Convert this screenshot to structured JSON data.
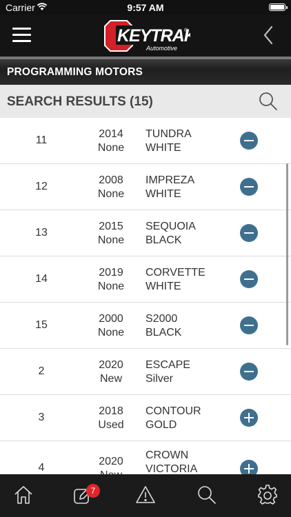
{
  "status_bar": {
    "carrier": "Carrier",
    "time": "9:57 AM"
  },
  "header": {
    "logo_text": "KEYTRAK",
    "logo_registered": "®",
    "logo_subtitle": "Automotive",
    "menu_icon": "hamburger-icon",
    "back_icon": "chevron-left-icon"
  },
  "section": {
    "title": "PROGRAMMING MOTORS"
  },
  "results": {
    "label": "SEARCH RESULTS (15)",
    "search_icon": "search-icon"
  },
  "rows": [
    {
      "num": "11",
      "year": "2014",
      "condition": "None",
      "model": "TUNDRA",
      "color": "WHITE",
      "action": "remove"
    },
    {
      "num": "12",
      "year": "2008",
      "condition": "None",
      "model": "IMPREZA",
      "color": "WHITE",
      "action": "remove"
    },
    {
      "num": "13",
      "year": "2015",
      "condition": "None",
      "model": "SEQUOIA",
      "color": "BLACK",
      "action": "remove"
    },
    {
      "num": "14",
      "year": "2019",
      "condition": "None",
      "model": "CORVETTE",
      "color": "WHITE",
      "action": "remove"
    },
    {
      "num": "15",
      "year": "2000",
      "condition": "None",
      "model": "S2000",
      "color": "BLACK",
      "action": "remove"
    },
    {
      "num": "2",
      "year": "2020",
      "condition": "New",
      "model": "ESCAPE",
      "color": "Silver",
      "action": "remove"
    },
    {
      "num": "3",
      "year": "2018",
      "condition": "Used",
      "model": "CONTOUR",
      "color": "GOLD",
      "action": "add"
    },
    {
      "num": "4",
      "year": "2020",
      "condition": "New",
      "model": "CROWN",
      "color": "VICTORIA",
      "action": "add"
    }
  ],
  "tab_bar": {
    "items": [
      "home-icon",
      "edit-icon",
      "warning-icon",
      "search-icon",
      "settings-icon"
    ],
    "badge_count": "7"
  },
  "colors": {
    "action_button": "#3f6f8f",
    "badge": "#e0262c",
    "logo_red": "#d42027"
  }
}
